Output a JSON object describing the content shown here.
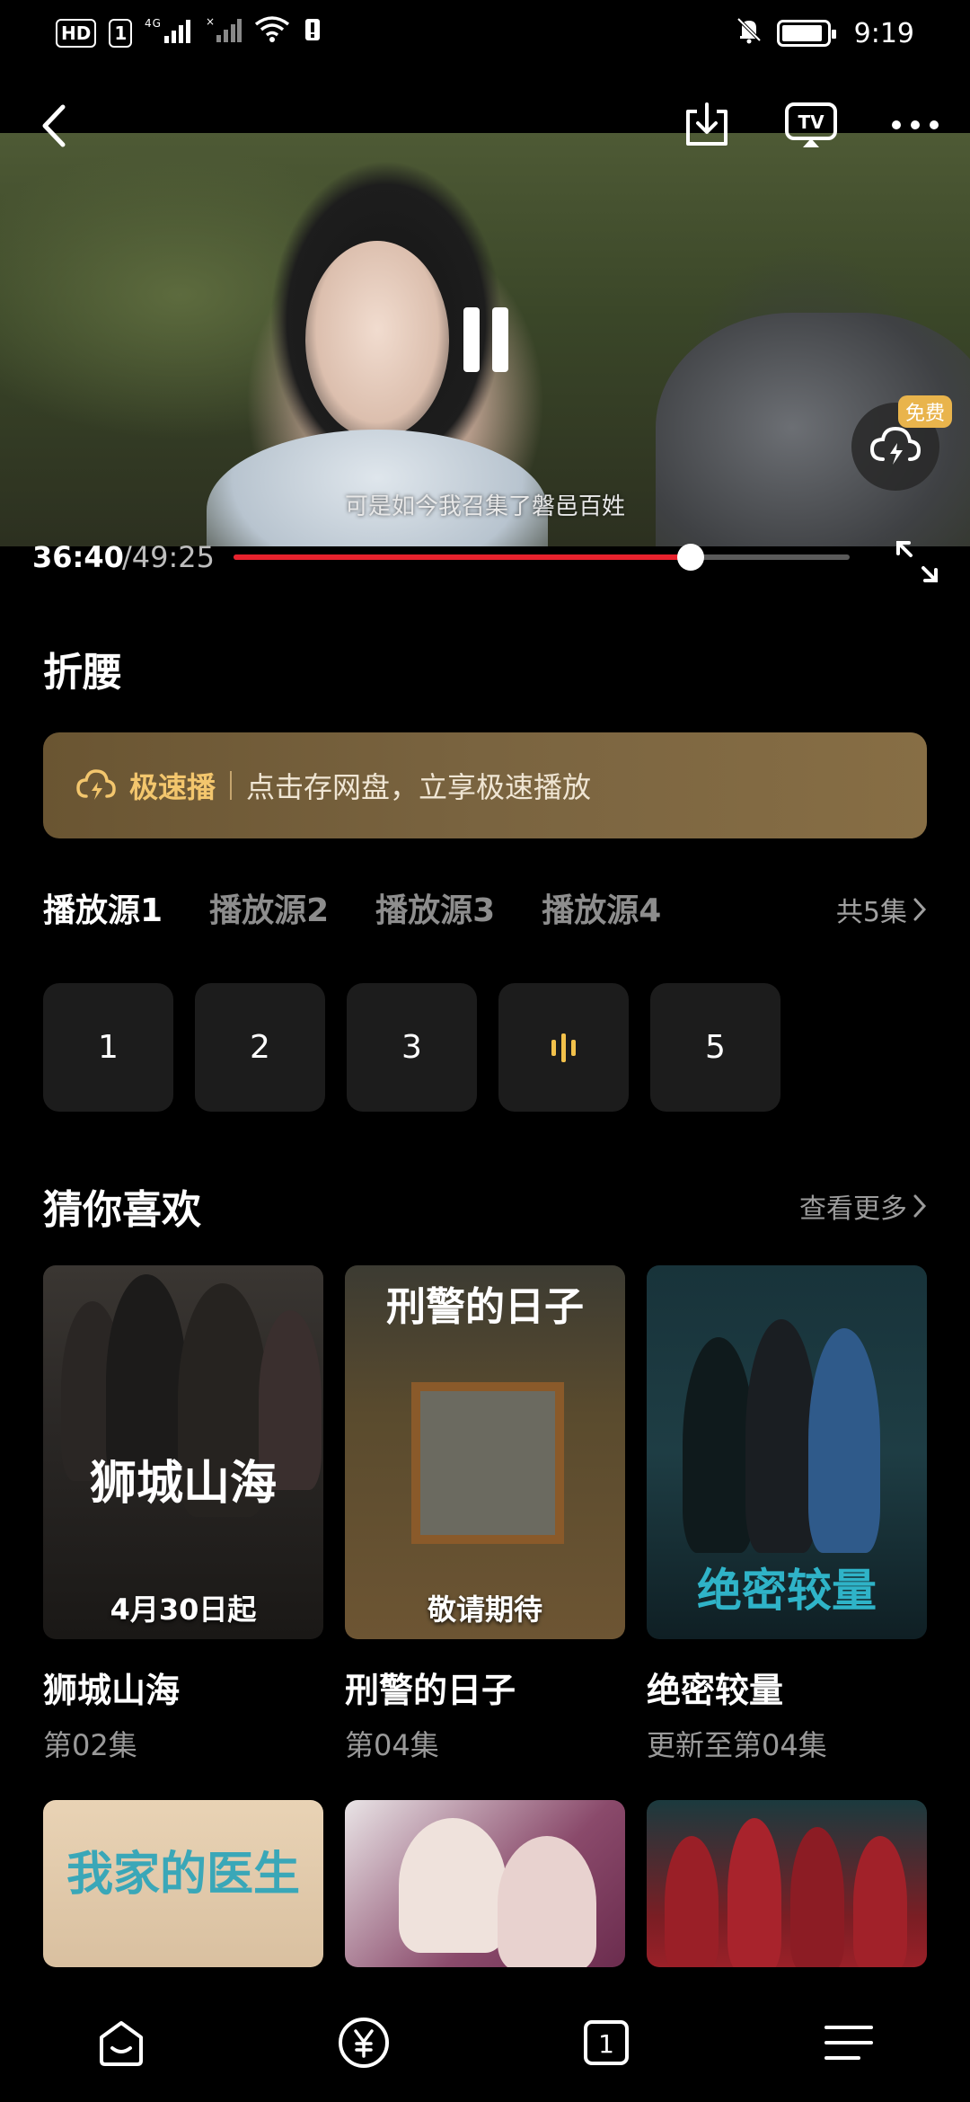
{
  "status_bar": {
    "hd_badge": "HD",
    "sim_badge": "1",
    "signal_1": "4G",
    "time": "9:19"
  },
  "player": {
    "subtitle": "可是如今我召集了磐邑百姓",
    "current_time": "36:40",
    "total_time": "/49:25",
    "progress": 0.742,
    "free_badge": "免费"
  },
  "title": "折腰",
  "banner": {
    "label": "极速播",
    "text": "点击存网盘，立享极速播放"
  },
  "sources": {
    "tabs": [
      "播放源1",
      "播放源2",
      "播放源3",
      "播放源4"
    ],
    "count_label": "共5集"
  },
  "episodes": [
    "1",
    "2",
    "3",
    "4",
    "5"
  ],
  "playing_episode": "4",
  "recommend": {
    "title": "猜你喜欢",
    "more": "查看更多",
    "items": [
      {
        "title": "狮城山海",
        "sub": "第02集",
        "poster_logo": "狮城山海",
        "poster_caption": "4月30日起"
      },
      {
        "title": "刑警的日子",
        "sub": "第04集",
        "poster_logo": "刑警的日子",
        "poster_caption": "敬请期待"
      },
      {
        "title": "绝密较量",
        "sub": "更新至第04集",
        "poster_logo": "绝密较量",
        "poster_caption": ""
      },
      {
        "title": "",
        "sub": "",
        "poster_logo": "我家的医生",
        "poster_caption": ""
      },
      {
        "title": "",
        "sub": "",
        "poster_logo": "",
        "poster_caption": ""
      },
      {
        "title": "",
        "sub": "",
        "poster_logo": "",
        "poster_caption": ""
      }
    ]
  },
  "colors": {
    "accent_red": "#e8222d",
    "accent_gold": "#f2c14b",
    "banner_brown": "#7a6440"
  }
}
